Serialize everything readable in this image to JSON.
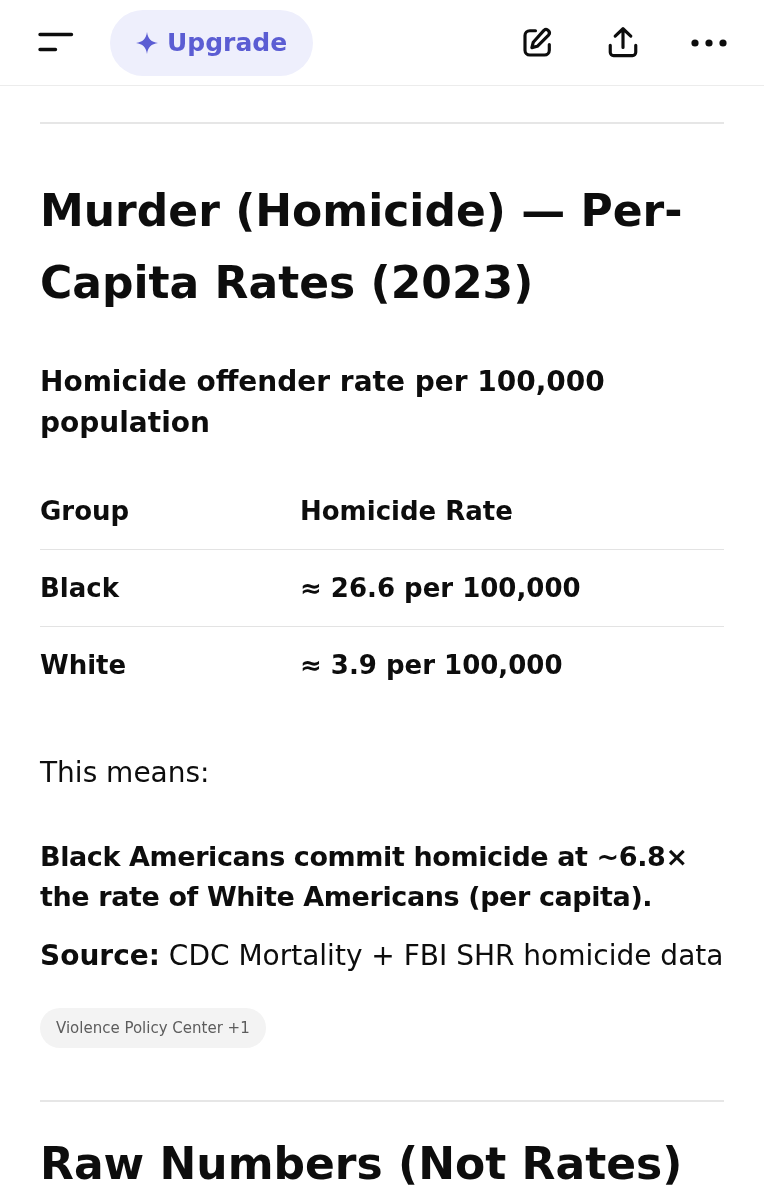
{
  "top_bar": {
    "upgrade_button": {
      "label": "Upgrade"
    }
  },
  "blocks": [
    {
      "kind": "rule"
    },
    {
      "kind": "heading",
      "text": "Murder (Homicide) — Per-Capita Rates (2023)"
    },
    {
      "kind": "subheading",
      "text": "Homicide offender rate per 100,000 population"
    },
    {
      "kind": "table",
      "columns": [
        "Group",
        "Homicide Rate"
      ],
      "rows": [
        [
          "Black",
          "≈ 26.6 per 100,000"
        ],
        [
          "White",
          "≈ 3.9 per 100,000"
        ]
      ]
    },
    {
      "kind": "paragraph",
      "text": "This means:"
    },
    {
      "kind": "emphasis",
      "text": "Black Americans commit homicide at ~6.8× the rate of White Americans (per capita)."
    },
    {
      "kind": "source",
      "text": "**Source:** CDC Mortality + FBI SHR homicide data",
      "citation": "Violence Policy Center +1"
    },
    {
      "kind": "rule"
    },
    {
      "kind": "heading",
      "text": "Raw Numbers (Not Rates)"
    }
  ]
}
